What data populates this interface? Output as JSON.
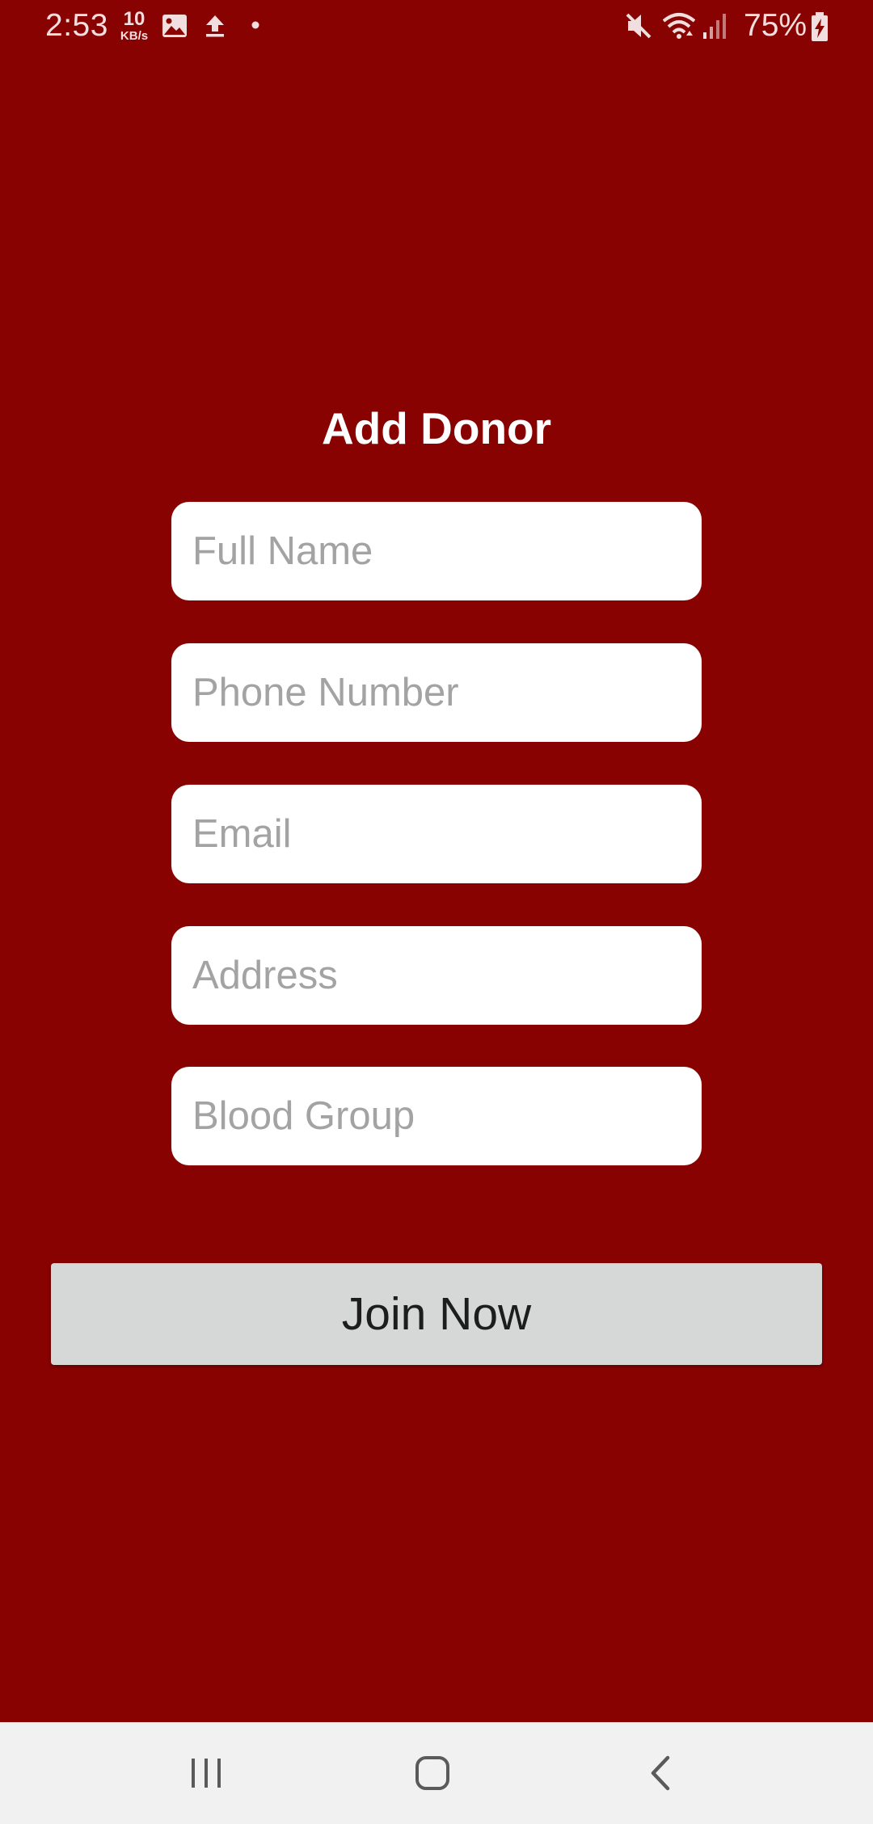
{
  "status_bar": {
    "time": "2:53",
    "net_speed_value": "10",
    "net_speed_unit": "KB/s",
    "battery_percent": "75%",
    "icons": [
      "image-icon",
      "upload-icon",
      "dot-icon",
      "mute-icon",
      "wifi-icon",
      "signal-icon",
      "battery-charging-icon"
    ]
  },
  "form": {
    "title": "Add Donor",
    "fields": {
      "full_name": {
        "placeholder": "Full Name",
        "value": ""
      },
      "phone_number": {
        "placeholder": "Phone Number",
        "value": ""
      },
      "email": {
        "placeholder": "Email",
        "value": ""
      },
      "address": {
        "placeholder": "Address",
        "value": ""
      },
      "blood_group": {
        "placeholder": "Blood Group",
        "value": ""
      }
    },
    "submit_label": "Join Now"
  },
  "nav_bar": {
    "buttons": [
      "recent-apps-icon",
      "home-icon",
      "back-icon"
    ]
  },
  "colors": {
    "background": "#880202",
    "field_background": "#ffffff",
    "placeholder": "#a3a3a3",
    "button_background": "#d6d7d7",
    "nav_background": "#f1f1f1"
  }
}
